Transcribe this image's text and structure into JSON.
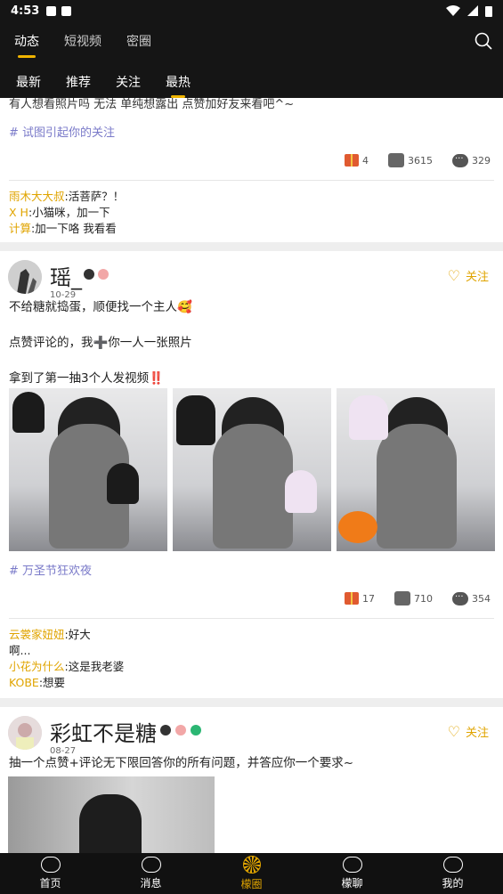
{
  "status": {
    "time": "4:53"
  },
  "top_tabs": [
    "动态",
    "短视频",
    "密圈"
  ],
  "sub_tabs": [
    "最新",
    "推荐",
    "关注",
    "最热"
  ],
  "post0": {
    "cut_text": "有人想看照片吗 无法 单纯想露出 点赞加好友来看吧^~",
    "topic": "# 试图引起你的关注",
    "gift_count": "4",
    "like_count": "3615",
    "comment_count": "329",
    "comments": [
      {
        "name": "雨木大大叔",
        "text": ":活菩萨？！"
      },
      {
        "name": "X H",
        "text": ":小猫咪，加一下"
      },
      {
        "name": "计算",
        "text": ":加一下咯 我看看"
      }
    ]
  },
  "post1": {
    "username": "瑶_",
    "date": "10-29",
    "follow_label": "关注",
    "lines": [
      "不给糖就捣蛋，顺便找一个主人🥰",
      "",
      "点赞评论的，我➕你一人一张照片",
      "",
      "拿到了第一抽3个人发视频‼️"
    ],
    "topic": "# 万圣节狂欢夜",
    "gift_count": "17",
    "like_count": "710",
    "comment_count": "354",
    "comments": [
      {
        "name": "云裳家妞妞",
        "text": ":好大"
      },
      {
        "name": "",
        "text": "啊..."
      },
      {
        "name": "小花为什么",
        "text": ":这是我老婆"
      },
      {
        "name": "KOBE",
        "text": ":想要"
      }
    ]
  },
  "post2": {
    "username": "彩虹不是糖",
    "date": "08-27",
    "follow_label": "关注",
    "text": "抽一个点赞+评论无下限回答你的所有问题，并答应你一个要求~"
  },
  "bottom_nav": [
    "首页",
    "消息",
    "檬圈",
    "檬聊",
    "我的"
  ],
  "colors": {
    "accent": "#e0a400",
    "topic": "#7a7ac9",
    "header": "#151515"
  }
}
